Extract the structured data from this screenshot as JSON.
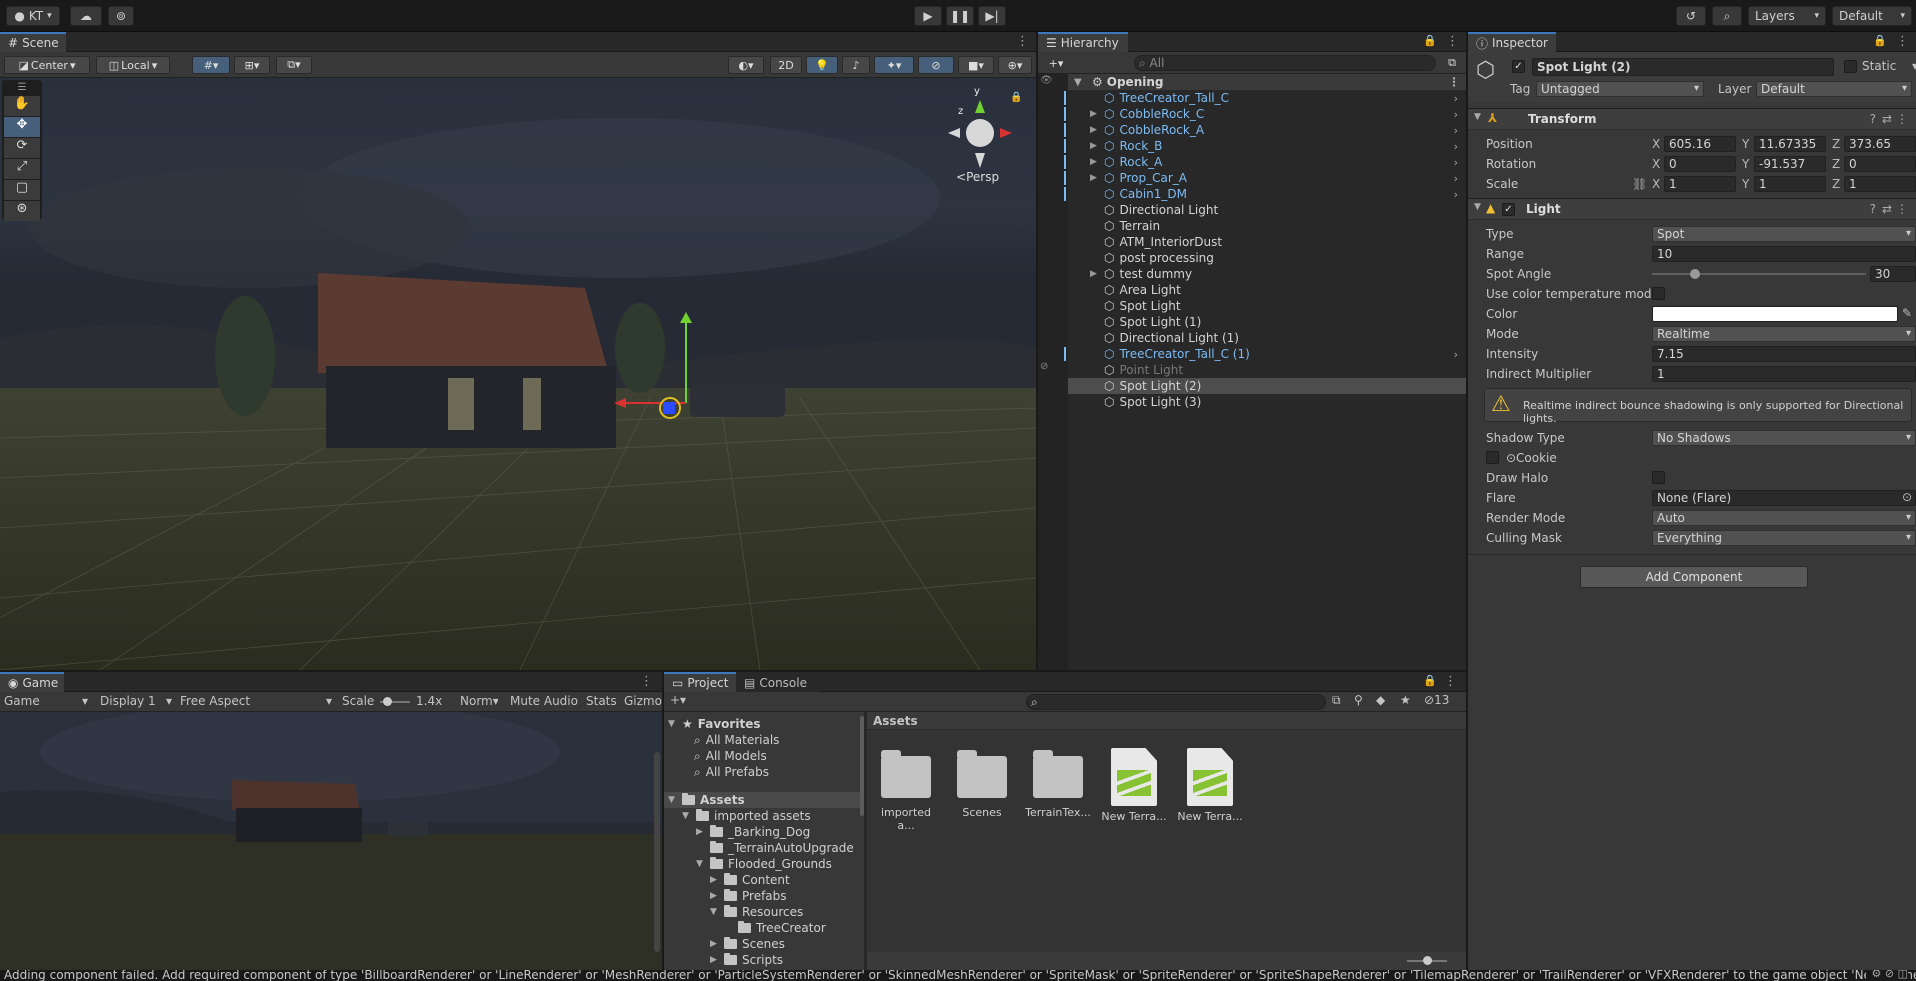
{
  "toolbar": {
    "account": "KT",
    "layers": "Layers",
    "layout": "Default"
  },
  "scene": {
    "tab": "Scene",
    "pivot": "Center",
    "space": "Local",
    "mode_2d": "2D",
    "view_label": "Persp",
    "gizmo_y": "y",
    "gizmo_z": "z"
  },
  "hierarchy": {
    "tab": "Hierarchy",
    "search_placeholder": "All",
    "root": "Opening",
    "items": [
      {
        "label": "TreeCreator_Tall_C",
        "prefab": true,
        "expand": false,
        "arrow": true
      },
      {
        "label": "CobbleRock_C",
        "prefab": true,
        "expand": true,
        "arrow": true
      },
      {
        "label": "CobbleRock_A",
        "prefab": true,
        "expand": true,
        "arrow": true
      },
      {
        "label": "Rock_B",
        "prefab": true,
        "expand": true,
        "arrow": true
      },
      {
        "label": "Rock_A",
        "prefab": true,
        "expand": true,
        "arrow": true
      },
      {
        "label": "Prop_Car_A",
        "prefab": true,
        "expand": true,
        "arrow": true
      },
      {
        "label": "Cabin1_DM",
        "prefab": true,
        "expand": false,
        "arrow": true
      },
      {
        "label": "Directional Light",
        "prefab": false
      },
      {
        "label": "Terrain",
        "prefab": false
      },
      {
        "label": "ATM_InteriorDust",
        "prefab": false
      },
      {
        "label": "post processing",
        "prefab": false
      },
      {
        "label": "test dummy",
        "prefab": false,
        "expand": true
      },
      {
        "label": "Area Light",
        "prefab": false
      },
      {
        "label": "Spot Light",
        "prefab": false
      },
      {
        "label": "Spot Light (1)",
        "prefab": false
      },
      {
        "label": "Directional Light (1)",
        "prefab": false
      },
      {
        "label": "TreeCreator_Tall_C (1)",
        "prefab": true,
        "arrow": true
      },
      {
        "label": "Point Light",
        "prefab": false,
        "disabled": true
      },
      {
        "label": "Spot Light (2)",
        "prefab": false,
        "selected": true
      },
      {
        "label": "Spot Light (3)",
        "prefab": false
      }
    ]
  },
  "inspector": {
    "tab": "Inspector",
    "object_name": "Spot Light (2)",
    "static_label": "Static",
    "tag_label": "Tag",
    "tag_value": "Untagged",
    "layer_label": "Layer",
    "layer_value": "Default",
    "transform": {
      "title": "Transform",
      "position_label": "Position",
      "rotation_label": "Rotation",
      "scale_label": "Scale",
      "position": {
        "x": "605.16",
        "y": "11.67335",
        "z": "373.65"
      },
      "rotation": {
        "x": "0",
        "y": "-91.537",
        "z": "0"
      },
      "scale": {
        "x": "1",
        "y": "1",
        "z": "1"
      }
    },
    "light": {
      "title": "Light",
      "type_label": "Type",
      "type_value": "Spot",
      "range_label": "Range",
      "range_value": "10",
      "angle_label": "Spot Angle",
      "angle_value": "30",
      "angle_fraction": 0.2,
      "colortemp_label": "Use color temperature mode",
      "color_label": "Color",
      "color_value": "#ffffff",
      "mode_label": "Mode",
      "mode_value": "Realtime",
      "intensity_label": "Intensity",
      "intensity_value": "7.15",
      "indirect_label": "Indirect Multiplier",
      "indirect_value": "1",
      "warning": "Realtime indirect bounce shadowing is only supported for Directional lights.",
      "shadow_label": "Shadow Type",
      "shadow_value": "No Shadows",
      "cookie_label": "Cookie",
      "halo_label": "Draw Halo",
      "flare_label": "Flare",
      "flare_value": "None (Flare)",
      "render_label": "Render Mode",
      "render_value": "Auto",
      "culling_label": "Culling Mask",
      "culling_value": "Everything"
    },
    "add_component": "Add Component"
  },
  "game": {
    "tab": "Game",
    "view": "Game",
    "display": "Display 1",
    "aspect": "Free Aspect",
    "scale_label": "Scale",
    "scale_value": "1.4x",
    "norm": "Norm",
    "mute": "Mute Audio",
    "stats": "Stats",
    "gizmos": "Gizmo",
    "scale_fraction": 0.1
  },
  "project": {
    "tab_project": "Project",
    "tab_console": "Console",
    "hidden_count": "13",
    "favorites_label": "Favorites",
    "favorites": [
      "All Materials",
      "All Models",
      "All Prefabs"
    ],
    "assets_root": "Assets",
    "tree": [
      {
        "label": "imported assets",
        "depth": 1,
        "arrow": "open"
      },
      {
        "label": "_Barking_Dog",
        "depth": 2,
        "arrow": "closed"
      },
      {
        "label": "_TerrainAutoUpgrade",
        "depth": 2,
        "arrow": ""
      },
      {
        "label": "Flooded_Grounds",
        "depth": 2,
        "arrow": "open"
      },
      {
        "label": "Content",
        "depth": 3,
        "arrow": "closed"
      },
      {
        "label": "Prefabs",
        "depth": 3,
        "arrow": "closed"
      },
      {
        "label": "Resources",
        "depth": 3,
        "arrow": "open"
      },
      {
        "label": "TreeCreator",
        "depth": 4,
        "arrow": ""
      },
      {
        "label": "Scenes",
        "depth": 3,
        "arrow": "closed"
      },
      {
        "label": "Scripts",
        "depth": 3,
        "arrow": "closed"
      }
    ],
    "breadcrumb": "Assets",
    "assets": [
      {
        "label": "imported a...",
        "kind": "folder"
      },
      {
        "label": "Scenes",
        "kind": "folder"
      },
      {
        "label": "TerrainTex...",
        "kind": "folder"
      },
      {
        "label": "New Terra...",
        "kind": "terrain"
      },
      {
        "label": "New Terra...",
        "kind": "terrain"
      }
    ]
  },
  "status": {
    "message": "Adding component failed. Add required component of type 'BillboardRenderer' or 'LineRenderer' or 'MeshRenderer' or 'ParticleSystemRenderer' or 'SkinnedMeshRenderer' or 'SpriteMask' or 'SpriteRenderer' or 'SpriteShapeRenderer' or 'TilemapRenderer' or 'TrailRenderer' or 'VFXRenderer' to the game object 'New Game"
  }
}
